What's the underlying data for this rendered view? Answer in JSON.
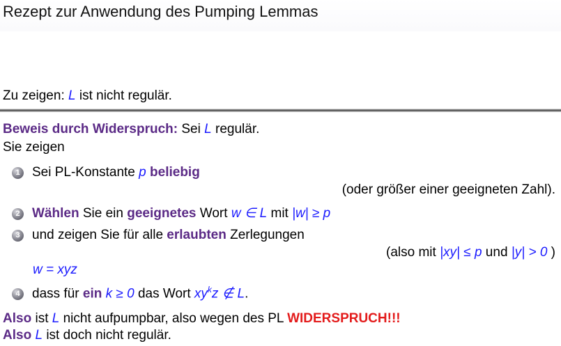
{
  "title": "Rezept zur Anwendung des Pumping Lemmas",
  "goal": {
    "prefix": "Zu zeigen: ",
    "L": "L",
    "suffix": " ist nicht regulär."
  },
  "proof": {
    "bold": "Beweis durch Widerspruch:",
    "mid": " Sei ",
    "L": "L",
    "end": " regulär."
  },
  "intro": "Sie zeigen",
  "steps": [
    {
      "num": "1",
      "a": "Sei PL-Konstante ",
      "p": "p",
      "b": "beliebig"
    },
    {
      "num": "2",
      "a": "Wählen",
      "b": " Sie ein ",
      "c": "geeignetes",
      "d": " Wort ",
      "e": "w ∈ L",
      "f": " mit ",
      "g": "|w| ≥ p"
    },
    {
      "num": "3",
      "a": "und zeigen Sie für alle ",
      "b": "erlaubten",
      "c": " Zerlegungen"
    },
    {
      "num": "4",
      "a": "dass für ",
      "b": "ein",
      "c": " k ≥ 0",
      "d": " das Wort ",
      "e": "xy",
      "sup": "k",
      "f": "z ∉ L",
      "g": "."
    }
  ],
  "note1": "(oder größer einer geeigneten Zahl).",
  "note3": {
    "a": "(also mit ",
    "b": "|xy| ≤ p",
    "c": " und ",
    "d": "|y| > 0",
    "e": " )"
  },
  "decomp": "w = xyz",
  "concl1": {
    "a": "Also",
    "b": " ist ",
    "L": "L",
    "c": " nicht aufpumpbar, also wegen des PL ",
    "d": "WIDERSPRUCH!!!"
  },
  "concl2": {
    "a": "Also",
    "L": " L",
    "c": " ist doch nicht regulär."
  }
}
